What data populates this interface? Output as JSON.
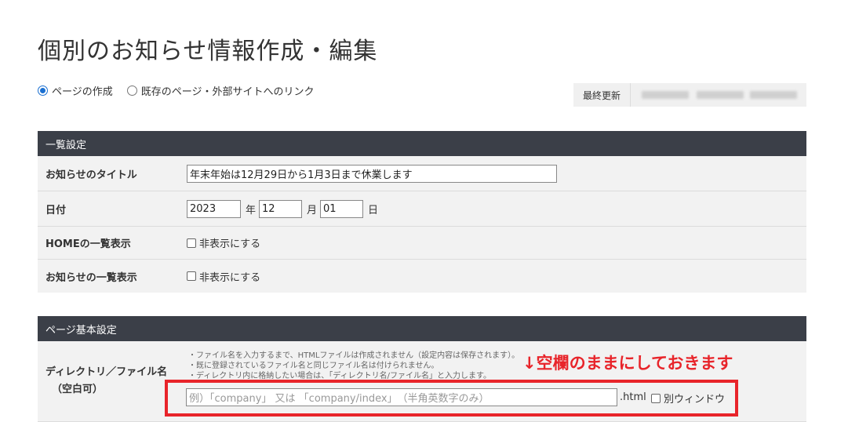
{
  "page_title": "個別のお知らせ情報作成・編集",
  "mode_options": [
    {
      "label": "ページの作成",
      "checked": true
    },
    {
      "label": "既存のページ・外部サイトへのリンク",
      "checked": false
    }
  ],
  "last_updated": {
    "label": "最終更新"
  },
  "list_settings": {
    "header": "一覧設定",
    "title_label": "お知らせのタイトル",
    "title_value": "年末年始は12月29日から1月3日まで休業します",
    "date_label": "日付",
    "date": {
      "year": "2023",
      "year_unit": "年",
      "month": "12",
      "month_unit": "月",
      "day": "01",
      "day_unit": "日"
    },
    "home_list_label": "HOMEの一覧表示",
    "home_list_checkbox": "非表示にする",
    "news_list_label": "お知らせの一覧表示",
    "news_list_checkbox": "非表示にする"
  },
  "basic_settings": {
    "header": "ページ基本設定",
    "dir_label": "ディレクトリ／ファイル名",
    "dir_label_sub": "（空白可）",
    "notes": [
      "・ファイル名を入力するまで、HTMLファイルは作成されません（設定内容は保存されます）。",
      "・既に登録されているファイル名と同じファイル名は付けられません。",
      "・ディレクトリ内に格納したい場合は、「ディレクトリ名/ファイル名」と入力します。"
    ],
    "dir_placeholder": "例）「company」 又は 「company/index」　（半角英数字のみ）",
    "html_suffix": ".html",
    "new_window_label": "別ウィンドウ"
  },
  "annotation": "↓空欄のままにしておきます",
  "colors": {
    "section_header": "#3b3f48",
    "annotation_red": "#e8242a",
    "radio_accent": "#1a6fd1"
  }
}
